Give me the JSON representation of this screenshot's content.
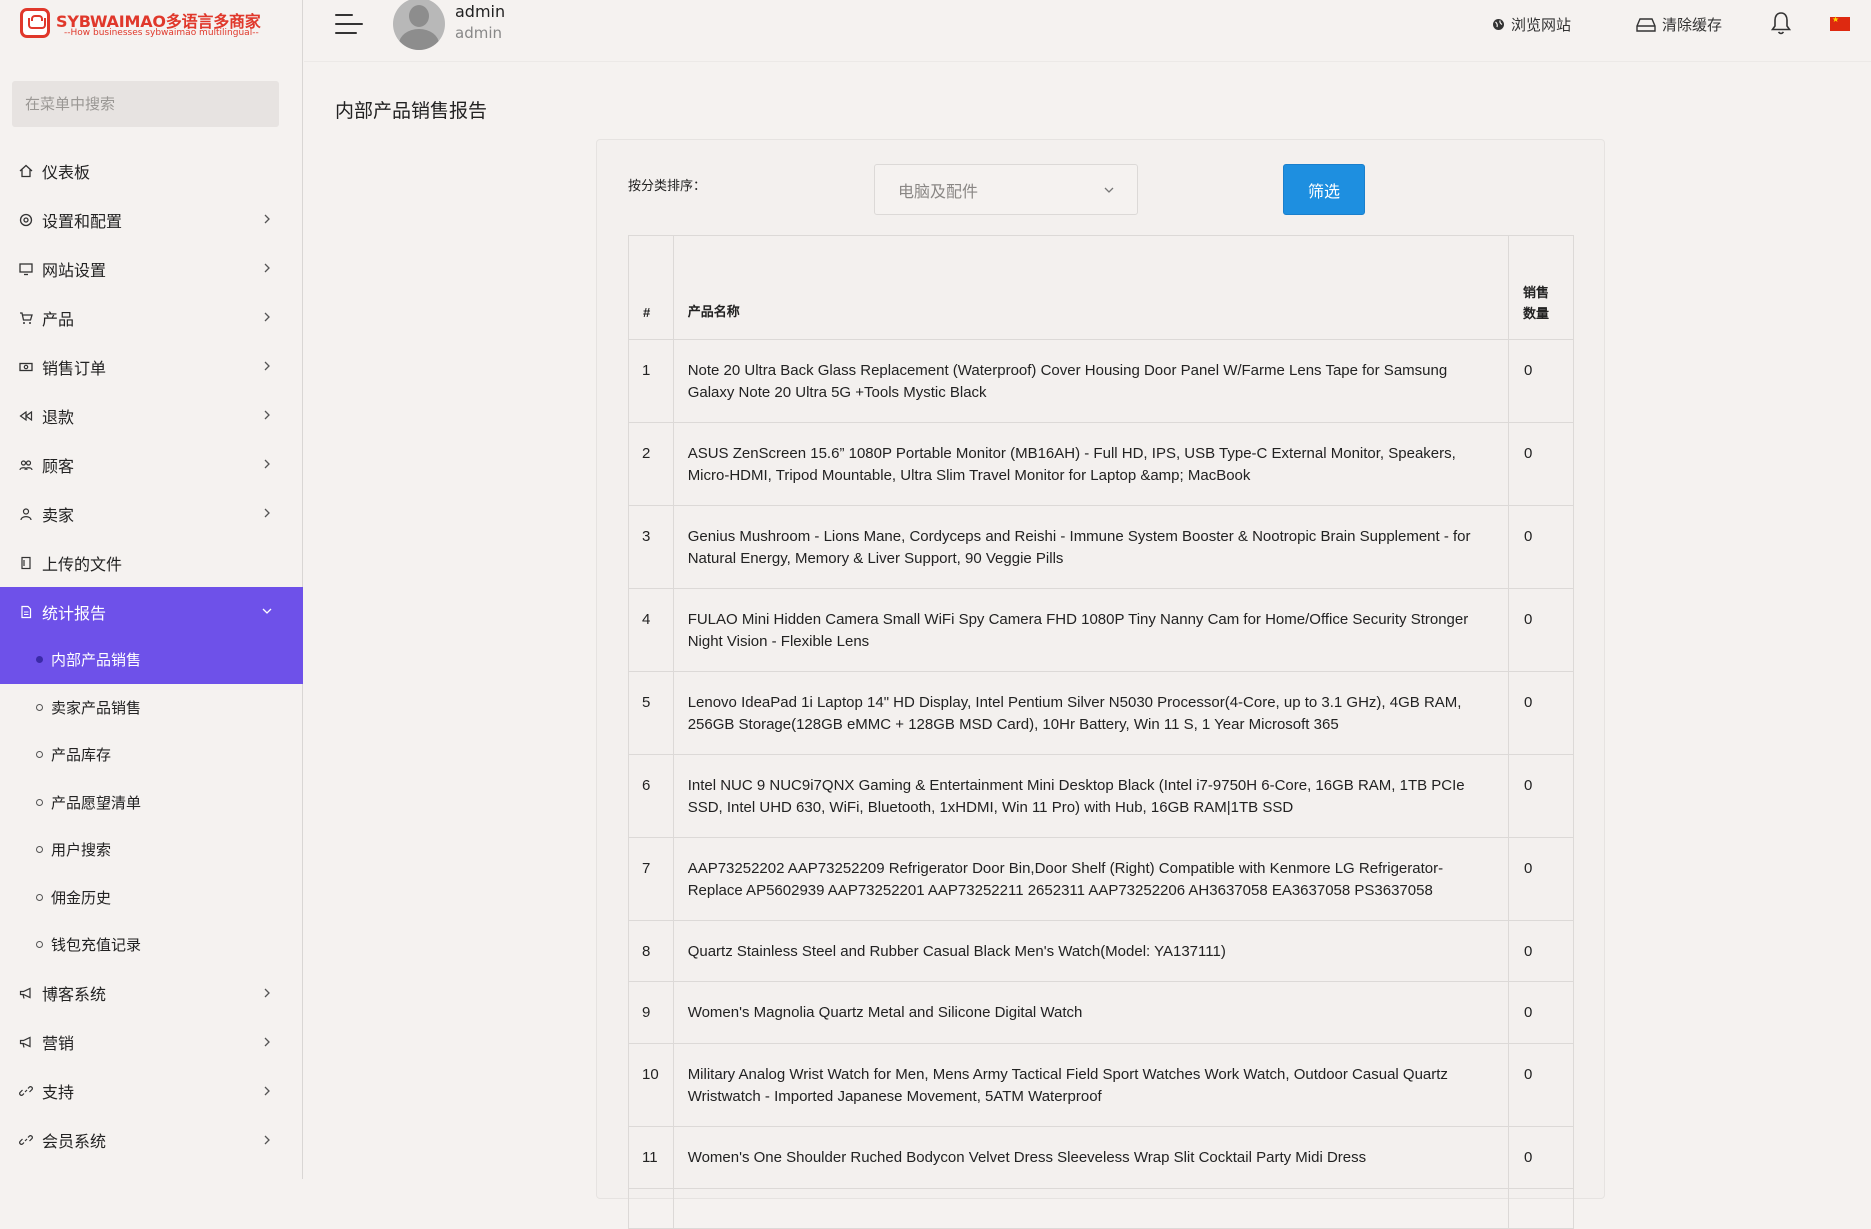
{
  "brand": {
    "name": "SYBWAIMAO多语言多商家",
    "tagline": "--How businesses sybwaimao multilingual--"
  },
  "sidebar": {
    "search_placeholder": "在菜单中搜索",
    "items": [
      {
        "label": "仪表板",
        "icon": "home-icon",
        "has_children": false
      },
      {
        "label": "设置和配置",
        "icon": "gear-icon",
        "has_children": true
      },
      {
        "label": "网站设置",
        "icon": "monitor-icon",
        "has_children": true
      },
      {
        "label": "产品",
        "icon": "cart-icon",
        "has_children": true
      },
      {
        "label": "销售订单",
        "icon": "money-icon",
        "has_children": true
      },
      {
        "label": "退款",
        "icon": "rewind-icon",
        "has_children": true
      },
      {
        "label": "顾客",
        "icon": "users-icon",
        "has_children": true
      },
      {
        "label": "卖家",
        "icon": "user-icon",
        "has_children": true
      },
      {
        "label": "上传的文件",
        "icon": "folder-icon",
        "has_children": false
      },
      {
        "label": "统计报告",
        "icon": "report-icon",
        "has_children": true,
        "expanded": true
      },
      {
        "label": "博客系统",
        "icon": "megaphone-icon",
        "has_children": true
      },
      {
        "label": "营销",
        "icon": "megaphone-icon",
        "has_children": true
      },
      {
        "label": "支持",
        "icon": "link-icon",
        "has_children": true
      },
      {
        "label": "会员系统",
        "icon": "link-icon",
        "has_children": true
      }
    ],
    "report_subitems": [
      {
        "label": "内部产品销售",
        "active": true
      },
      {
        "label": "卖家产品销售",
        "active": false
      },
      {
        "label": "产品库存",
        "active": false
      },
      {
        "label": "产品愿望清单",
        "active": false
      },
      {
        "label": "用户搜索",
        "active": false
      },
      {
        "label": "佣金历史",
        "active": false
      },
      {
        "label": "钱包充值记录",
        "active": false
      }
    ]
  },
  "topbar": {
    "username": "admin",
    "role": "admin",
    "browse_site": "浏览网站",
    "clear_cache": "清除缓存"
  },
  "page": {
    "title": "内部产品销售报告",
    "filter_label": "按分类排序：",
    "category_selected": "电脑及配件",
    "filter_button": "筛选"
  },
  "table": {
    "headers": {
      "index": "#",
      "name": "产品名称",
      "qty_line1": "销售",
      "qty_line2": "数量"
    },
    "rows": [
      {
        "index": "1",
        "name": "Note 20 Ultra Back Glass Replacement (Waterproof) Cover Housing Door Panel W/Farme Lens Tape for Samsung Galaxy Note 20 Ultra 5G +Tools Mystic Black",
        "qty": "0"
      },
      {
        "index": "2",
        "name": "ASUS ZenScreen 15.6” 1080P Portable Monitor (MB16AH) - Full HD, IPS, USB Type-C External Monitor, Speakers, Micro-HDMI, Tripod Mountable, Ultra Slim Travel Monitor for Laptop &amp; MacBook",
        "qty": "0"
      },
      {
        "index": "3",
        "name": "Genius Mushroom - Lions Mane, Cordyceps and Reishi - Immune System Booster & Nootropic Brain Supplement - for Natural Energy, Memory & Liver Support, 90 Veggie Pills",
        "qty": "0"
      },
      {
        "index": "4",
        "name": "FULAO Mini Hidden Camera Small WiFi Spy Camera FHD 1080P Tiny Nanny Cam for Home/Office Security Stronger Night Vision - Flexible Lens",
        "qty": "0"
      },
      {
        "index": "5",
        "name": "Lenovo IdeaPad 1i Laptop 14\" HD Display, Intel Pentium Silver N5030 Processor(4-Core, up to 3.1 GHz), 4GB RAM, 256GB Storage(128GB eMMC + 128GB MSD Card), 10Hr Battery, Win 11 S, 1 Year Microsoft 365",
        "qty": "0"
      },
      {
        "index": "6",
        "name": "Intel NUC 9 NUC9i7QNX Gaming & Entertainment Mini Desktop Black (Intel i7-9750H 6-Core, 16GB RAM, 1TB PCIe SSD, Intel UHD 630, WiFi, Bluetooth, 1xHDMI, Win 11 Pro) with Hub, 16GB RAM|1TB SSD",
        "qty": "0"
      },
      {
        "index": "7",
        "name": "AAP73252202 AAP73252209 Refrigerator Door Bin,Door Shelf (Right) Compatible with Kenmore LG Refrigerator-Replace AP5602939 AAP73252201 AAP73252211 2652311 AAP73252206 AH3637058 EA3637058 PS3637058",
        "qty": "0"
      },
      {
        "index": "8",
        "name": "Quartz Stainless Steel and Rubber Casual Black Men's Watch(Model: YA137111)",
        "qty": "0"
      },
      {
        "index": "9",
        "name": "Women's Magnolia Quartz Metal and Silicone Digital Watch",
        "qty": "0"
      },
      {
        "index": "10",
        "name": "Military Analog Wrist Watch for Men, Mens Army Tactical Field Sport Watches Work Watch, Outdoor Casual Quartz Wristwatch - Imported Japanese Movement, 5ATM Waterproof",
        "qty": "0"
      },
      {
        "index": "11",
        "name": "Women's One Shoulder Ruched Bodycon Velvet Dress Sleeveless Wrap Slit Cocktail Party Midi Dress",
        "qty": "0"
      },
      {
        "index": "",
        "name": "",
        "qty": ""
      }
    ]
  },
  "colors": {
    "accent": "#6e51e9",
    "button": "#1e8fe0",
    "brand": "#e0382b"
  }
}
